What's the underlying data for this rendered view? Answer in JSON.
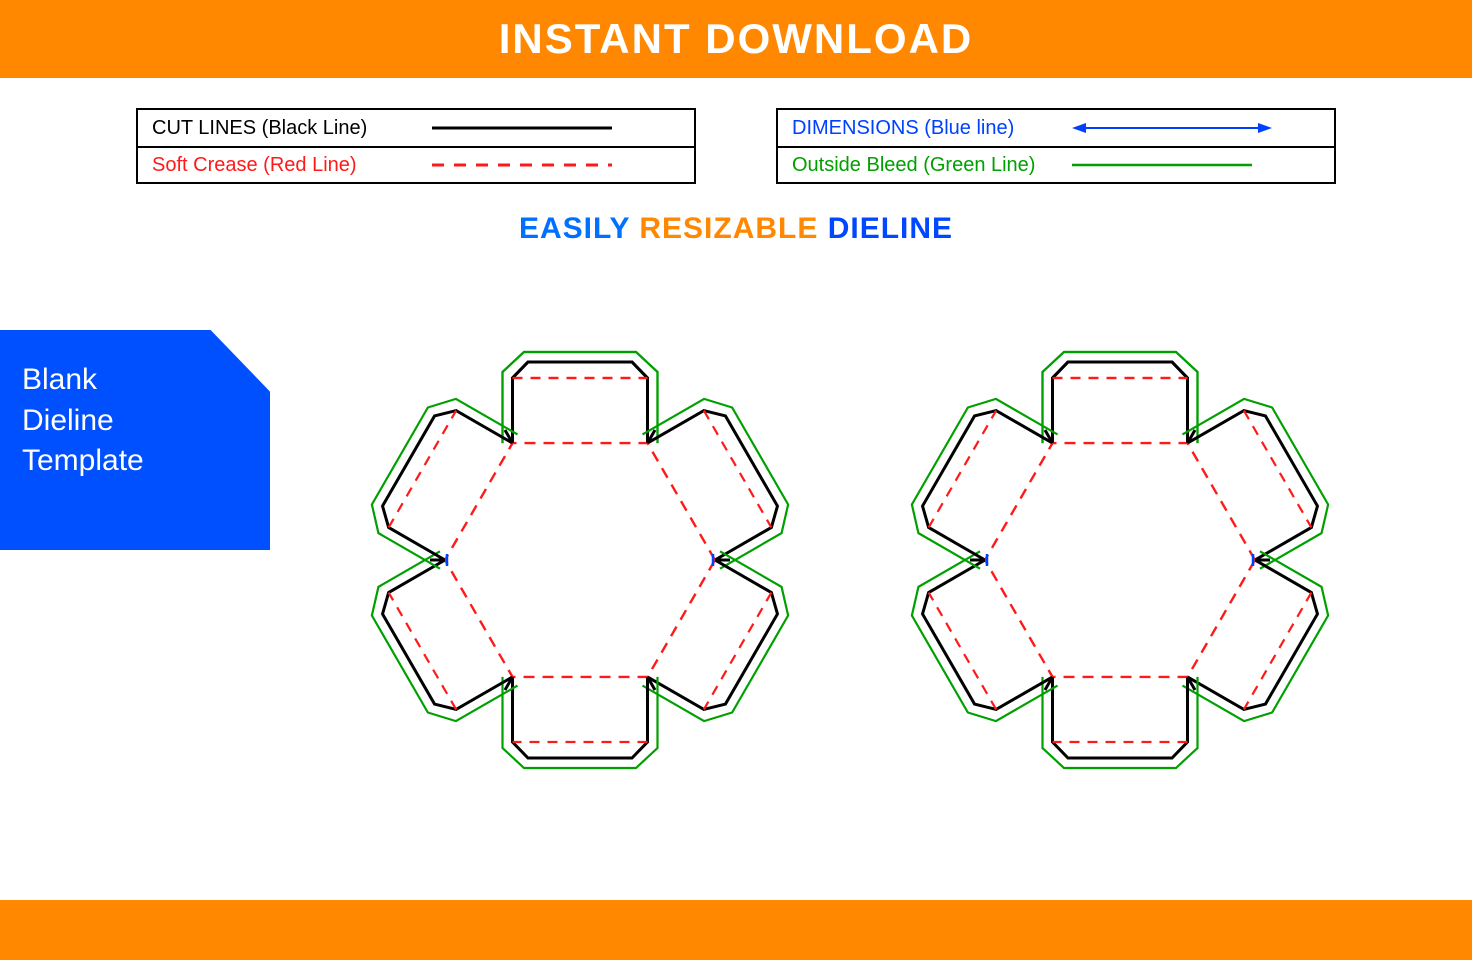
{
  "header": {
    "title": "INSTANT DOWNLOAD"
  },
  "legend": {
    "left": [
      {
        "label": "CUT LINES (Black Line)",
        "color": "#000000",
        "style": "solid"
      },
      {
        "label": "Soft Crease (Red Line)",
        "color": "#ff1a1a",
        "style": "dashed"
      }
    ],
    "right": [
      {
        "label": "DIMENSIONS (Blue line)",
        "color": "#0040ff",
        "style": "arrow"
      },
      {
        "label": "Outside Bleed (Green Line)",
        "color": "#00a000",
        "style": "solid"
      }
    ]
  },
  "subheading": {
    "word1": "EASILY",
    "word2": "RESIZABLE",
    "word3": "DIELINE"
  },
  "side_badge": {
    "line1": "Blank",
    "line2": "Dieline",
    "line3": "Template"
  },
  "colors": {
    "orange": "#ff8800",
    "blue": "#0050ff",
    "cut": "#000000",
    "crease": "#ff1a1a",
    "dimension": "#0040ff",
    "bleed": "#00a000"
  },
  "diagram": {
    "description": "Two identical hexagonal box dieline templates with tuck flaps on each of six sides. Black solid = cut lines, red dashed = fold/crease lines, green solid = outside bleed outline."
  }
}
